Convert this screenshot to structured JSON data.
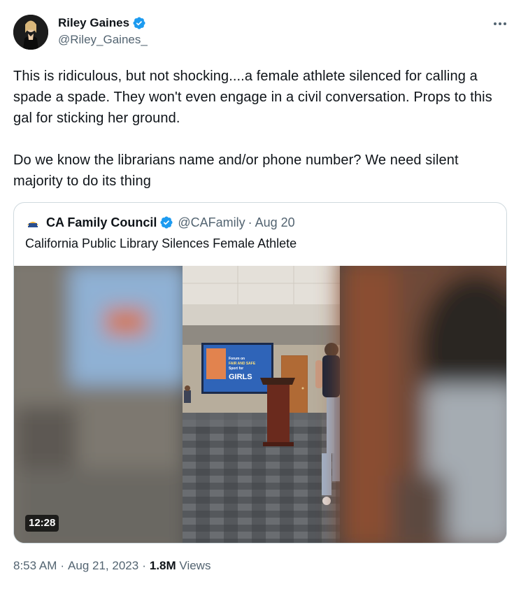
{
  "author": {
    "name": "Riley Gaines",
    "handle": "@Riley_Gaines_",
    "verified": true
  },
  "more_icon": "more-horizontal-icon",
  "body_text": "This is ridiculous, but not shocking....a female athlete silenced for calling a spade a spade. They won't even engage in a civil conversation. Props to this gal for sticking her ground.\n\nDo we know the librarians name and/or phone number? We need silent majority to do its thing",
  "quote": {
    "name": "CA Family Council",
    "handle": "@CAFamily",
    "separator": "·",
    "date": "Aug 20",
    "verified": true,
    "text": "California Public Library Silences Female Athlete",
    "video": {
      "duration": "12:28",
      "projector_text": [
        "Forum on",
        "FAIR AND SAFE",
        "Sport for",
        "GIRLS"
      ]
    }
  },
  "meta": {
    "time": "8:53 AM",
    "separator": "·",
    "date": "Aug 21, 2023",
    "separator2": "·",
    "views_count": "1.8M",
    "views_label": "Views"
  },
  "colors": {
    "text_primary": "#0f1419",
    "text_secondary": "#536471",
    "verified_blue": "#1d9bf0",
    "border": "#cfd9de"
  }
}
